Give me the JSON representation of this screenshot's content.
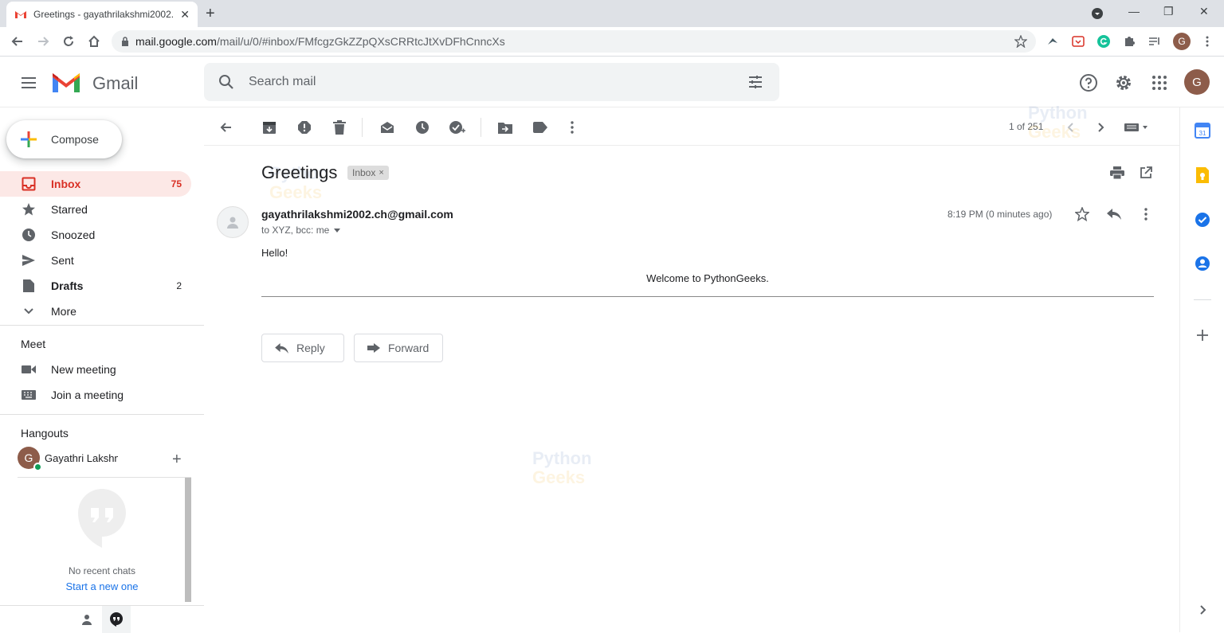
{
  "browser": {
    "tab_title": "Greetings - gayathrilakshmi2002.",
    "tab_close": "✕",
    "new_tab": "+",
    "url_host": "mail.google.com",
    "url_path": "/mail/u/0/#inbox/FMfcgzGkZZpQXsCRRtcJtXvDFhCnncXs",
    "profile_initial": "G",
    "window_controls": [
      "—",
      "❐",
      "✕"
    ]
  },
  "header": {
    "app_name": "Gmail",
    "search_placeholder": "Search mail",
    "account_initial": "G"
  },
  "sidebar": {
    "compose_label": "Compose",
    "items": [
      {
        "label": "Inbox",
        "count": "75",
        "icon": "inbox-icon"
      },
      {
        "label": "Starred",
        "count": "",
        "icon": "star-icon"
      },
      {
        "label": "Snoozed",
        "count": "",
        "icon": "clock-icon"
      },
      {
        "label": "Sent",
        "count": "",
        "icon": "send-icon"
      },
      {
        "label": "Drafts",
        "count": "2",
        "icon": "draft-icon"
      },
      {
        "label": "More",
        "count": "",
        "icon": "chevron-down-icon"
      }
    ],
    "meet": {
      "title": "Meet",
      "items": [
        {
          "label": "New meeting",
          "icon": "video-icon"
        },
        {
          "label": "Join a meeting",
          "icon": "keyboard-icon"
        }
      ]
    },
    "hangouts": {
      "title": "Hangouts",
      "user_initial": "G",
      "user_name": "Gayathri Lakshmi",
      "add": "+",
      "no_chats": "No recent chats",
      "start_new": "Start a new one"
    }
  },
  "toolbar": {
    "pager": "1 of 251"
  },
  "message": {
    "subject": "Greetings",
    "label": "Inbox",
    "label_remove": "×",
    "sender": "gayathrilakshmi2002.ch@gmail.com",
    "to_line": "to XYZ, bcc: me",
    "time": "8:19 PM (0 minutes ago)",
    "body_line1": "Hello!",
    "body_line2": "Welcome to PythonGeeks.",
    "reply_label": "Reply",
    "forward_label": "Forward"
  },
  "watermark": {
    "line1": "Python",
    "line2": "Geeks"
  },
  "colors": {
    "accent": "#d93025",
    "link": "#1a73e8",
    "online": "#0f9d58"
  }
}
